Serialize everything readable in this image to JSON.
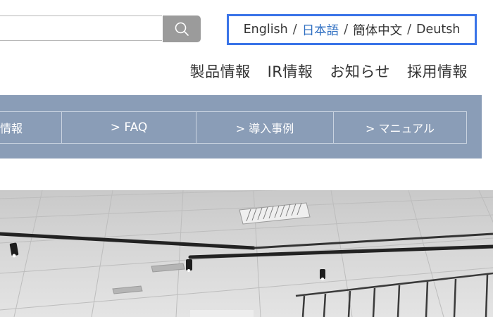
{
  "search": {
    "placeholder": "",
    "value": "",
    "button_icon": "search-icon"
  },
  "languages": [
    {
      "label": "English",
      "active": false
    },
    {
      "label": "日本語",
      "active": true
    },
    {
      "label": "簡体中文",
      "active": false
    },
    {
      "label": "Deutsh",
      "active": false
    }
  ],
  "language_separator": "/",
  "main_nav": {
    "products": "製品情報",
    "ir": "IR情報",
    "news": "お知らせ",
    "recruit": "採用情報"
  },
  "sub_nav": {
    "first": "情報",
    "faq": ">  FAQ",
    "cases": "> 導入事例",
    "manual": "> マニュアル"
  },
  "colors": {
    "lang_border": "#3a74e8",
    "active_lang": "#2f6fc2",
    "sub_nav_bg": "#8a9db7",
    "search_button": "#9b9b9b"
  }
}
